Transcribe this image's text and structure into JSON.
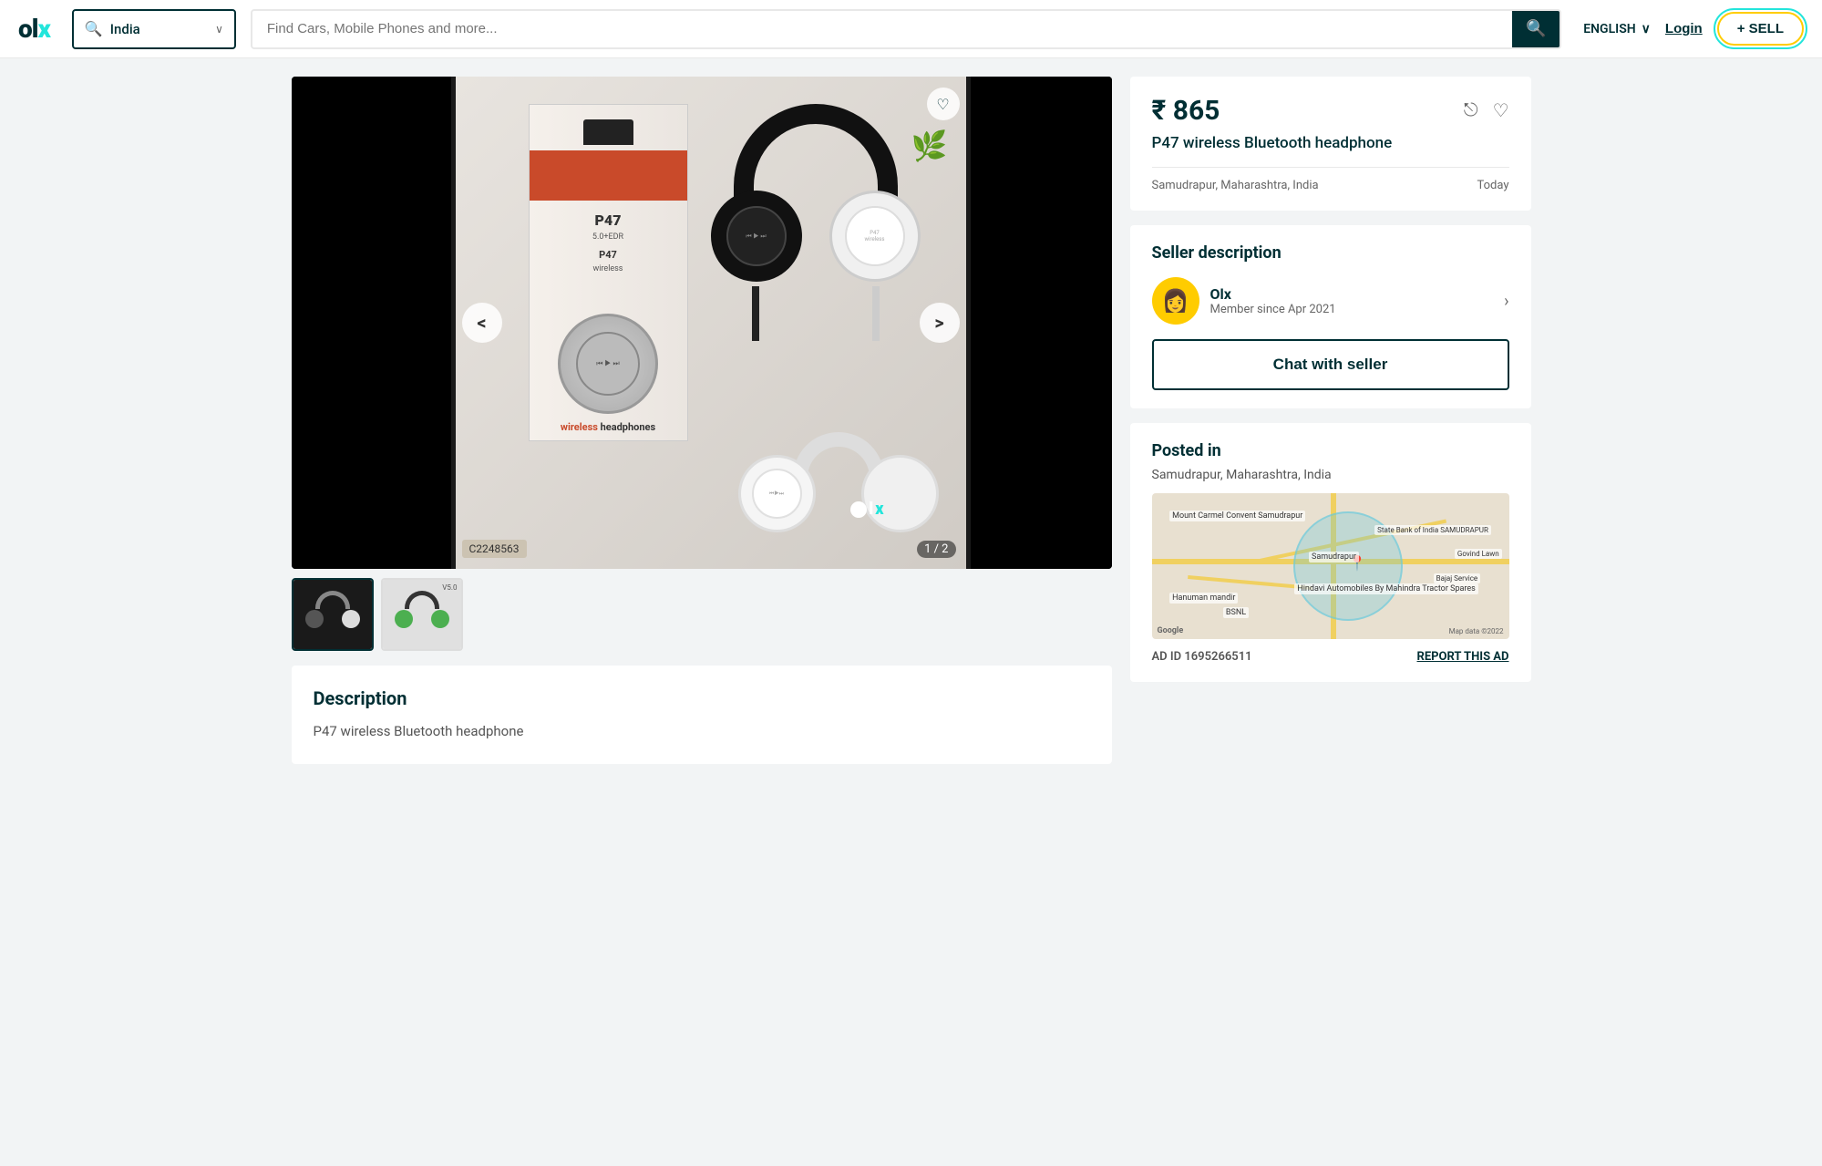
{
  "header": {
    "logo": "OLX",
    "location_placeholder": "India",
    "search_placeholder": "Find Cars, Mobile Phones and more...",
    "language": "ENGLISH",
    "login_label": "Login",
    "sell_label": "+ SELL"
  },
  "product": {
    "price": "₹ 865",
    "title": "P47 wireless Bluetooth headphone",
    "location": "Samudrapur, Maharashtra, India",
    "date_posted": "Today",
    "image_counter": "1 / 2",
    "ad_id_badge": "C2248563",
    "heart_icon": "♡",
    "prev_icon": "<",
    "next_icon": ">"
  },
  "thumbnails": [
    {
      "label": "Thumbnail 1"
    },
    {
      "label": "Thumbnail 2"
    }
  ],
  "description": {
    "title": "Description",
    "text": "P47 wireless Bluetooth headphone"
  },
  "seller": {
    "section_title": "Seller description",
    "name": "Olx",
    "member_since": "Member since Apr 2021",
    "chat_button": "Chat with seller",
    "avatar_emoji": "👩"
  },
  "posted_in": {
    "title": "Posted in",
    "location": "Samudrapur, Maharashtra, India"
  },
  "footer": {
    "ad_id_label": "AD ID 1695266511",
    "report_label": "REPORT THIS AD"
  },
  "map_labels": {
    "google": "Google",
    "map_data": "Map data ©2022",
    "samudrapur": "Samudrapur",
    "state_bank": "State Bank of India\nSAMUDRAPUR",
    "mount_carmel": "Mount Carmel\nConvent Samudrapur",
    "hanuman": "Hanuman mandir",
    "hindavi": "Hindavi Automobiles By\nMahindra Tractor Spares",
    "bsnl": "BSNL",
    "bajaj": "Bajaj Service",
    "govind": "Govind Lawn"
  },
  "icons": {
    "share": "⎋",
    "heart_outline": "♡",
    "search": "🔍",
    "chevron_down": "∨",
    "chevron_right": "›"
  }
}
